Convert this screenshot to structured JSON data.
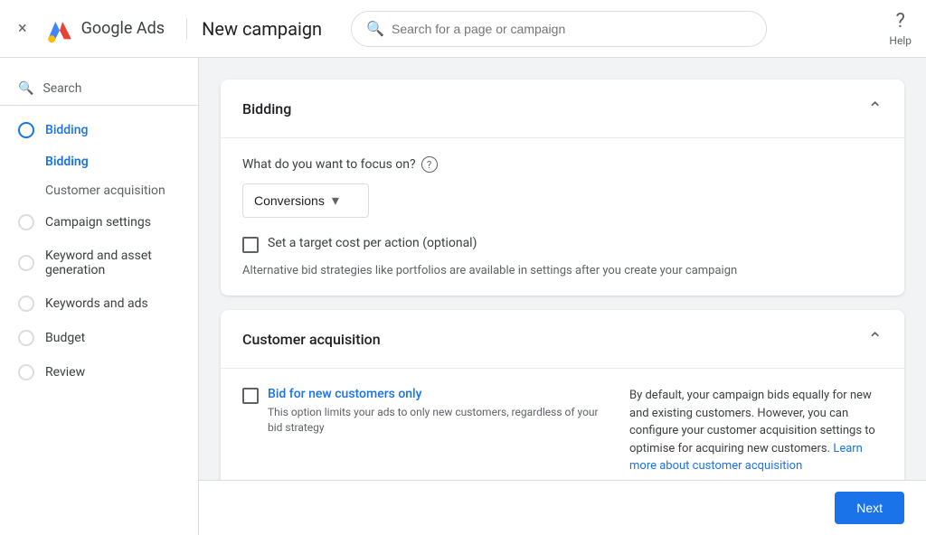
{
  "topbar": {
    "close_label": "×",
    "logo_text": "Google Ads",
    "campaign_title": "New campaign",
    "search_placeholder": "Search for a page or campaign",
    "help_label": "Help"
  },
  "sidebar": {
    "search_icon": "☰",
    "search_label": "Search",
    "items": [
      {
        "id": "bidding",
        "label": "Bidding",
        "active": true
      },
      {
        "id": "campaign-settings",
        "label": "Campaign settings",
        "active": false
      },
      {
        "id": "keyword-asset",
        "label": "Keyword and asset generation",
        "active": false
      },
      {
        "id": "keywords-ads",
        "label": "Keywords and ads",
        "active": false
      },
      {
        "id": "budget",
        "label": "Budget",
        "active": false
      },
      {
        "id": "review",
        "label": "Review",
        "active": false
      }
    ],
    "sub_items": [
      {
        "id": "bidding-sub",
        "label": "Bidding",
        "active": true
      },
      {
        "id": "customer-acquisition-sub",
        "label": "Customer acquisition",
        "active": false
      }
    ]
  },
  "bidding_card": {
    "title": "Bidding",
    "focus_label": "What do you want to focus on?",
    "focus_tooltip": "?",
    "dropdown_value": "Conversions",
    "dropdown_arrow": "▾",
    "checkbox_label": "Set a target cost per action (optional)",
    "alt_text": "Alternative bid strategies like portfolios are available in settings after you create your campaign"
  },
  "customer_acquisition_card": {
    "title": "Customer acquisition",
    "bid_label": "Bid for new customers only",
    "bid_sublabel": "This option limits your ads to only new customers, regardless of your bid strategy",
    "info_text": "By default, your campaign bids equally for new and existing customers. However, you can configure your customer acquisition settings to optimise for acquiring new customers.",
    "link_text": "Learn more about customer acquisition"
  },
  "footer": {
    "next_label": "Next"
  }
}
